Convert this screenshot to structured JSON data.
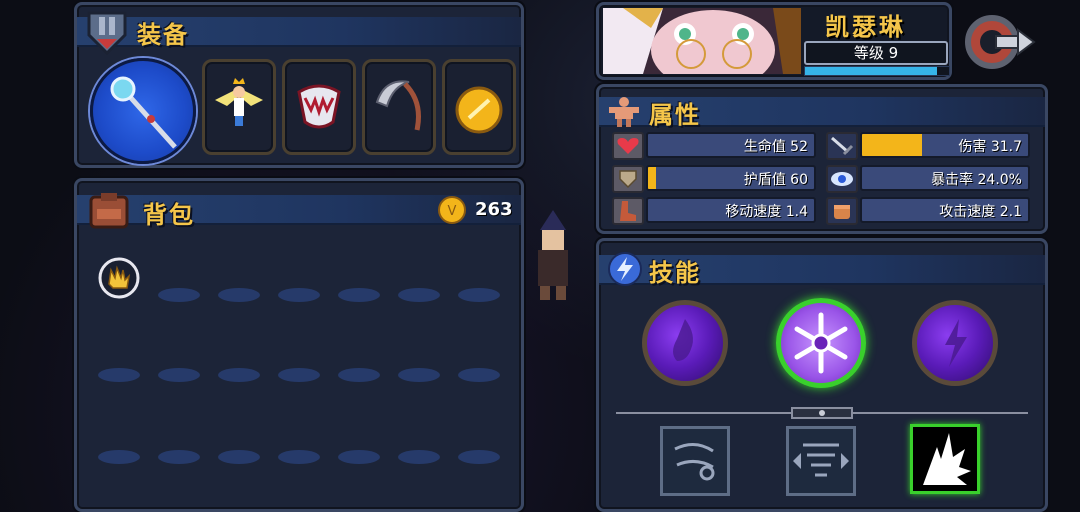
{
  "equipment": {
    "title": "装备"
  },
  "backpack": {
    "title": "背包",
    "coins": "263"
  },
  "character": {
    "name": "凯瑟琳",
    "level_label": "等级 9",
    "xp_progress": 0.92
  },
  "attributes": {
    "title": "属性",
    "stats": [
      {
        "key": "hp",
        "label": "生命值 52",
        "fill": 0.0
      },
      {
        "key": "damage",
        "label": "伤害 31.7",
        "fill": 0.36
      },
      {
        "key": "armor",
        "label": "护盾值 60",
        "fill": 0.05
      },
      {
        "key": "crit",
        "label": "暴击率 24.0%",
        "fill": 0.0
      },
      {
        "key": "move_speed",
        "label": "移动速度 1.4",
        "fill": 0.0
      },
      {
        "key": "attack_speed",
        "label": "攻击速度 2.1",
        "fill": 0.0
      }
    ]
  },
  "skills": {
    "title": "技能"
  },
  "colors": {
    "accent_gold": "#f5c64a",
    "selected_green": "#39d02c",
    "bar_fill": "#f3b51a"
  }
}
